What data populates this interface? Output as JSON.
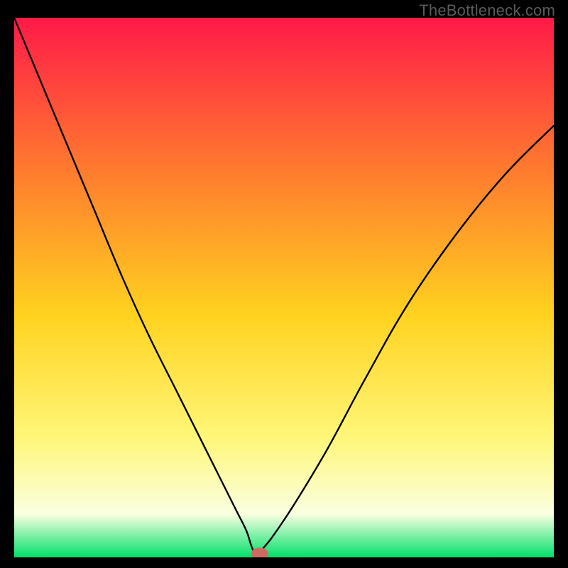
{
  "watermark": "TheBottleneck.com",
  "colors": {
    "frame": "#000000",
    "curve": "#000000",
    "marker": "#cf6a63",
    "watermark_text": "#5a5a5a",
    "gradient_top": "#ff1a48",
    "gradient_mid1": "#ff7a2f",
    "gradient_mid2": "#ffd21f",
    "gradient_mid3": "#fff77a",
    "gradient_band": "#faffe0",
    "gradient_bottom": "#00e06a"
  },
  "chart_data": {
    "type": "line",
    "title": "",
    "xlabel": "",
    "ylabel": "",
    "xlim": [
      0,
      100
    ],
    "ylim": [
      0,
      100
    ],
    "grid": false,
    "legend": false,
    "minimum": {
      "x": 45,
      "y": 0
    },
    "marker": {
      "x": 45.5,
      "y": 0.7,
      "rx": 1.6,
      "ry": 1.1
    },
    "series": [
      {
        "name": "bottleneck-curve",
        "x": [
          0,
          5,
          10,
          15,
          20,
          25,
          30,
          34,
          38,
          41,
          43,
          44,
          45,
          46,
          48,
          52,
          58,
          65,
          73,
          82,
          91,
          100
        ],
        "y": [
          100,
          88,
          76,
          64,
          52,
          41,
          31,
          23,
          15,
          9,
          5,
          2,
          0,
          1.5,
          4,
          10,
          20,
          33,
          47,
          60,
          71,
          80
        ]
      }
    ]
  }
}
